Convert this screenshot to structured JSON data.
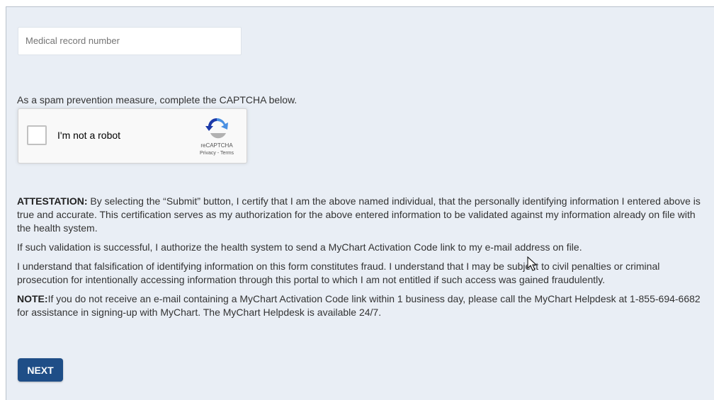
{
  "form": {
    "mrn_placeholder": "Medical record number"
  },
  "captcha": {
    "intro": "As a spam prevention measure, complete the CAPTCHA below.",
    "checkbox_label": "I'm not a robot",
    "brand": "reCAPTCHA",
    "privacy_link": "Privacy",
    "separator": " - ",
    "terms_link": "Terms"
  },
  "attestation": {
    "p1_lead": "ATTESTATION:",
    "p1_body": " By selecting the “Submit” button, I certify that I am the above named individual, that the personally identifying information I entered above is true and accurate. This certification serves as my authorization for the above entered information to be validated against my information already on file with the health system.",
    "p2": "If such validation is successful, I authorize the health system to send a MyChart Activation Code link to my e-mail address on file.",
    "p3": "I understand that falsification of identifying information on this form constitutes fraud. I understand that I may be subject to civil penalties or criminal prosecution for intentionally accessing information through this portal to which I am not entitled if such access was gained fraudulently.",
    "note_lead": "NOTE:",
    "note_body": "If you do not receive an e-mail containing a MyChart Activation Code link within 1 business day, please call the MyChart Helpdesk at 1-855-694-6682 for assistance in signing-up with MyChart. The MyChart Helpdesk is available 24/7."
  },
  "actions": {
    "next_label": "NEXT"
  },
  "colors": {
    "panel_background": "#e9eef5",
    "next_button": "#1f4e87",
    "recaptcha_blue": "#4a90e2",
    "recaptcha_dark_blue": "#1c3aa9",
    "recaptcha_gray": "#b1b1b1"
  },
  "icons": {
    "recaptcha_logo": "recaptcha-logo-icon",
    "cursor": "mouse-cursor-icon"
  }
}
